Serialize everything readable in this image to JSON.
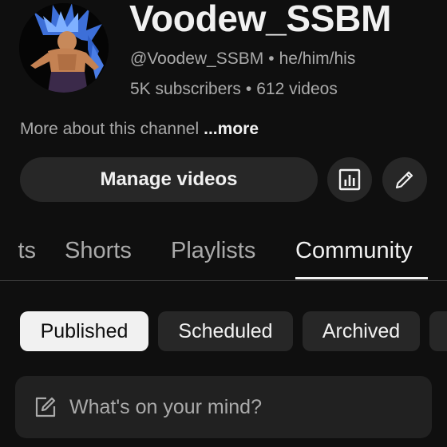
{
  "channel": {
    "name": "Voodew_SSBM",
    "handle": "@Voodew_SSBM",
    "pronouns": "he/him/his",
    "subscribers": "5K subscribers",
    "videos": "612 videos",
    "separator": "•"
  },
  "about": {
    "text": "More about this channel",
    "more_label": "...more"
  },
  "actions": {
    "manage_videos_label": "Manage videos",
    "analytics_icon": "analytics-icon",
    "edit_icon": "pencil-icon"
  },
  "tabs": [
    {
      "label": "Posts",
      "visible_fragment": "ts",
      "selected": false
    },
    {
      "label": "Shorts",
      "selected": false
    },
    {
      "label": "Playlists",
      "selected": false
    },
    {
      "label": "Community",
      "selected": true
    }
  ],
  "filters": [
    {
      "label": "Published",
      "selected": true
    },
    {
      "label": "Scheduled",
      "selected": false
    },
    {
      "label": "Archived",
      "selected": false
    }
  ],
  "composer": {
    "placeholder": "What's on your mind?",
    "icon": "compose-icon"
  },
  "colors": {
    "background": "#0f0f0f",
    "surface": "#272727",
    "text_primary": "#f1f1f1",
    "text_secondary": "#aaaaaa",
    "selected_chip": "#f1f1f1"
  }
}
